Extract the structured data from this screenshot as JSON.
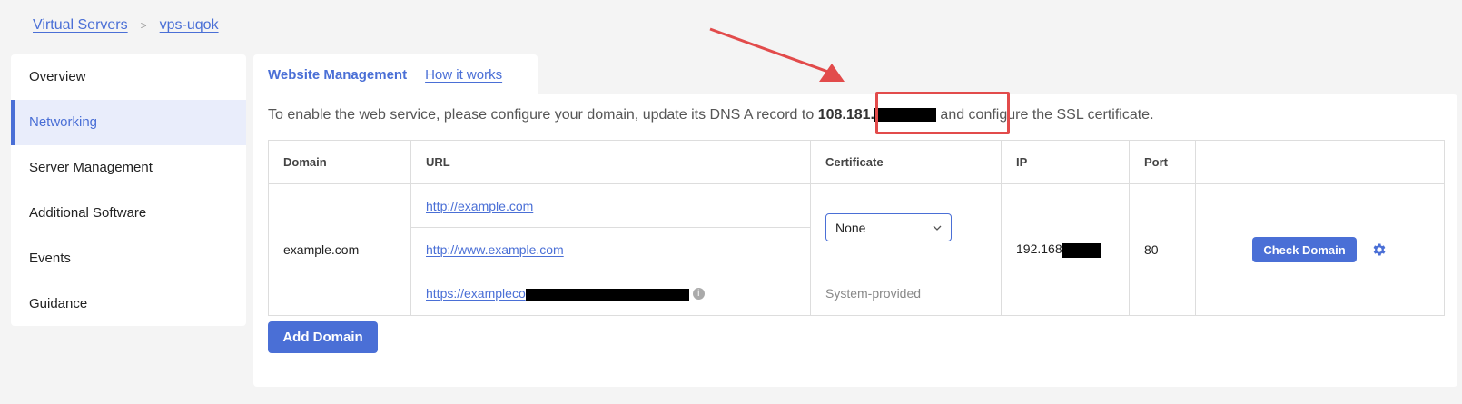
{
  "breadcrumb": {
    "root": "Virtual Servers",
    "separator": ">",
    "current": "vps-uqok"
  },
  "sidebar": {
    "items": [
      {
        "label": "Overview"
      },
      {
        "label": "Networking"
      },
      {
        "label": "Server Management"
      },
      {
        "label": "Additional Software"
      },
      {
        "label": "Events"
      },
      {
        "label": "Guidance"
      }
    ],
    "active_index": 1
  },
  "tab": {
    "title": "Website Management",
    "how_link": "How it works"
  },
  "notice": {
    "before": "To enable the web service, please configure your domain, update its DNS A record to ",
    "ip_visible": "108.181.",
    "after": " and configure the SSL certificate."
  },
  "table": {
    "headers": {
      "domain": "Domain",
      "url": "URL",
      "certificate": "Certificate",
      "ip": "IP",
      "port": "Port",
      "actions": ""
    },
    "row": {
      "domain": "example.com",
      "urls": [
        "http://example.com",
        "http://www.example.com",
        "https://exampleco"
      ],
      "certificate_selected": "None",
      "certificate_system": "System-provided",
      "ip_visible": "192.168",
      "port": "80",
      "check_button": "Check Domain"
    }
  },
  "add_button": "Add Domain",
  "colors": {
    "accent": "#4a6fd6",
    "highlight": "#e24b4b",
    "active_bg": "#e9edfb"
  },
  "icons": {
    "settings": "gear-icon",
    "info": "info-icon",
    "dropdown": "chevron-down-icon"
  }
}
